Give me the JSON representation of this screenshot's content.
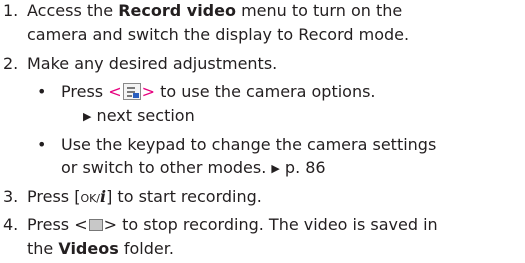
{
  "step1": {
    "num": "1.",
    "line1_pre": "Access the ",
    "line1_bold": "Record video",
    "line1_post": " menu to turn on the",
    "line2": "camera and switch the display to Record mode."
  },
  "step2": {
    "num": "2.",
    "text": " Make any desired adjustments.",
    "bullet1": {
      "pre": "Press ",
      "lt": "<",
      "gt": ">",
      "post": " to use the camera options.",
      "ref_arrow": "▶",
      "ref": " next section"
    },
    "bullet2": {
      "line1": "Use the keypad to change the camera settings",
      "line2_pre": "or switch to other modes. ",
      "ref_arrow": "▶",
      "ref": " p. 86"
    }
  },
  "step3": {
    "num": "3.",
    "pre": "Press [",
    "key_ok": "OK/",
    "key_i": "i",
    "post": "] to start recording."
  },
  "step4": {
    "num": "4.",
    "pre": "Press <",
    "post": "> to stop recording. The video is saved in",
    "line2_pre": "the ",
    "line2_bold": "Videos",
    "line2_post": " folder."
  },
  "colors": {
    "text": "#231f20",
    "accent": "#e6007e"
  },
  "icons": {
    "menu_icon": "camera-options-icon",
    "stop_icon": "stop-icon",
    "arrow_icon": "triangle-right-icon"
  }
}
